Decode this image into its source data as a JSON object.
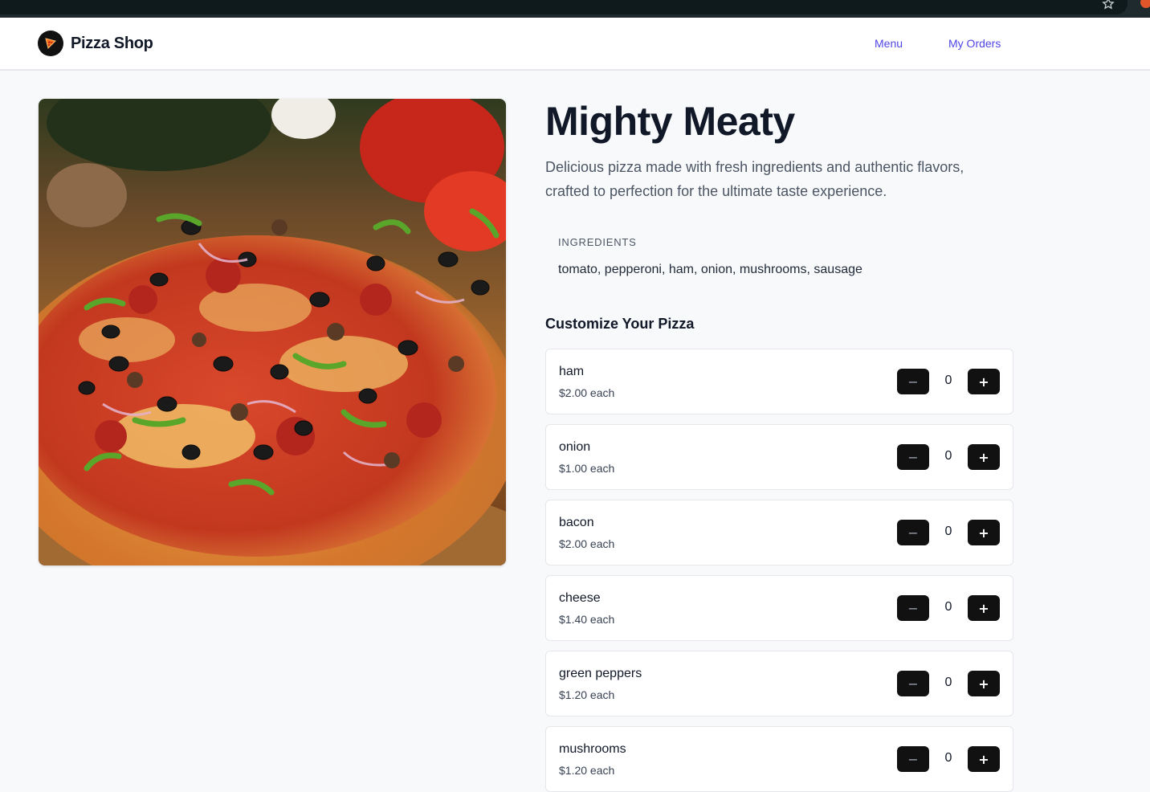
{
  "browser": {
    "url_fragment": "947012e1-105f-4303-9c45-52875abe41ec"
  },
  "header": {
    "brand": "Pizza Shop",
    "nav": [
      {
        "label": "Menu"
      },
      {
        "label": "My Orders"
      }
    ]
  },
  "product": {
    "title": "Mighty Meaty",
    "description": "Delicious pizza made with fresh ingredients and authentic flavors, crafted to perfection for the ultimate taste experience.",
    "ingredients_label": "INGREDIENTS",
    "ingredients": "tomato, pepperoni, ham, onion, mushrooms, sausage",
    "image_alt": "pizza photo"
  },
  "customize": {
    "title": "Customize Your Pizza",
    "minus_label": "−",
    "plus_label": "+",
    "toppings": [
      {
        "name": "ham",
        "price": "$2.00 each",
        "qty": "0"
      },
      {
        "name": "onion",
        "price": "$1.00 each",
        "qty": "0"
      },
      {
        "name": "bacon",
        "price": "$2.00 each",
        "qty": "0"
      },
      {
        "name": "cheese",
        "price": "$1.40 each",
        "qty": "0"
      },
      {
        "name": "green peppers",
        "price": "$1.20 each",
        "qty": "0"
      },
      {
        "name": "mushrooms",
        "price": "$1.20 each",
        "qty": "0"
      }
    ]
  },
  "colors": {
    "accent": "#4f46e5",
    "button": "#111111",
    "page_bg": "#f8f9fb"
  }
}
